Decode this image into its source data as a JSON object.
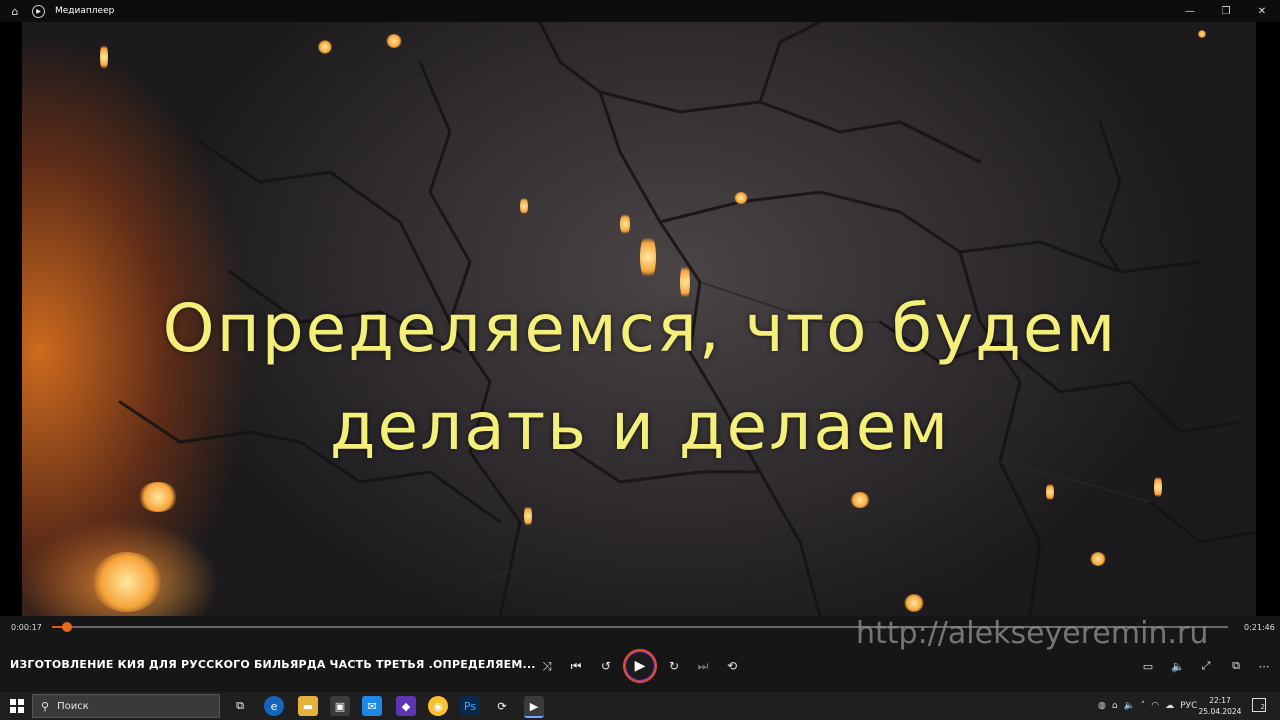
{
  "window": {
    "title": "Медиаплеер",
    "controls": [
      "minimize",
      "maximize",
      "close"
    ]
  },
  "video": {
    "caption_line1": "Определяемся, что будем",
    "caption_line2": "делать и делаем"
  },
  "player": {
    "current_time": "0:00:17",
    "total_time": "0:21:46",
    "progress": 0.013,
    "media_title": "ИЗГОТОВЛЕНИЕ КИЯ ДЛЯ РУССКОГО БИЛЬЯРДА ЧАСТЬ ТРЕТЬЯ .ОПРЕДЕЛЯЕМ...",
    "watermark": "http://alekseyeremin.ru",
    "accent_color": "#e05a10"
  },
  "taskbar": {
    "search_placeholder": "Поиск",
    "language": "РУС",
    "time": "22:17",
    "date": "25.04.2024",
    "notification_count": "2"
  }
}
